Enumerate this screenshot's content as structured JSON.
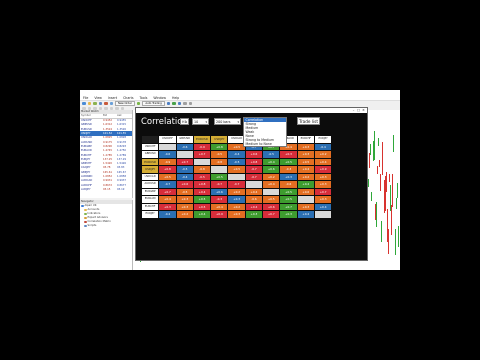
{
  "app": {
    "title": "",
    "menu": [
      "File",
      "View",
      "Insert",
      "Charts",
      "Tools",
      "Window",
      "Help"
    ],
    "toolbar_buttons": [
      "New Order",
      "Auto Trading"
    ]
  },
  "market_watch": {
    "title": "Market Watch",
    "columns": [
      "Symbol",
      "Bid",
      "Ask"
    ],
    "rows": [
      {
        "symbol": "USDCHF",
        "bid": "0.9452",
        "ask": "0.9455"
      },
      {
        "symbol": "GBPUSD",
        "bid": "1.6312",
        "ask": "1.6315"
      },
      {
        "symbol": "EURUSD",
        "bid": "1.3524",
        "ask": "1.3526"
      },
      {
        "symbol": "USDJPY",
        "bid": "101.52",
        "ask": "101.55",
        "selected": true
      },
      {
        "symbol": "USDCAD",
        "bid": "1.0825",
        "ask": "1.0828"
      },
      {
        "symbol": "AUDUSD",
        "bid": "0.9175",
        "ask": "0.9178"
      },
      {
        "symbol": "EURGBP",
        "bid": "0.8290",
        "ask": "0.8293"
      },
      {
        "symbol": "EURAUD",
        "bid": "1.4745",
        "ask": "1.4750"
      },
      {
        "symbol": "EURCHF",
        "bid": "1.2785",
        "ask": "1.2789"
      },
      {
        "symbol": "EURJPY",
        "bid": "137.25",
        "ask": "137.29"
      },
      {
        "symbol": "GBPCHF",
        "bid": "1.5420",
        "ask": "1.5426"
      },
      {
        "symbol": "CADJPY",
        "bid": "93.78",
        "ask": "93.83"
      },
      {
        "symbol": "GBPJPY",
        "bid": "165.61",
        "ask": "165.67"
      },
      {
        "symbol": "AUDNZD",
        "bid": "1.0852",
        "ask": "1.0858"
      },
      {
        "symbol": "AUDCAD",
        "bid": "0.9931",
        "ask": "0.9937"
      },
      {
        "symbol": "AUDCHF",
        "bid": "0.8672",
        "ask": "0.8677"
      },
      {
        "symbol": "AUDJPY",
        "bid": "93.15",
        "ask": "93.19"
      }
    ]
  },
  "navigator": {
    "title": "Navigator",
    "items": [
      "Alpari UK",
      "Accounts",
      "Indicators",
      "Expert Advisors",
      "Correlation Matrix",
      "Scripts"
    ]
  },
  "correlation": {
    "window_title": "",
    "title": "Correlation",
    "dropdown1": "H1",
    "dropdown2": "10",
    "dropdown3": "200 bars",
    "dropdown4": "Correlation",
    "trade_list": "Trade list",
    "menu_options": [
      "Correlation",
      "Strong",
      "Medium",
      "Weak",
      "None",
      "Strong to Medium",
      "Medium to None"
    ],
    "columns": [
      "USDCHF",
      "GBPUSD",
      "EURUSD",
      "USDJPY",
      "USDCAD",
      "AUDUSD",
      "EURGBP",
      "EURAUD",
      "EURCHF",
      "EURJPY"
    ],
    "rows": [
      {
        "label": "USDCHF",
        "cells": [
          [
            "diag",
            ""
          ],
          [
            "c-blue",
            "-0.6"
          ],
          [
            "c-red",
            "-0.9"
          ],
          [
            "c-green",
            "+0.8"
          ],
          [
            "c-orange",
            "+0.5"
          ],
          [
            "c-blue",
            "-0.7"
          ],
          [
            "c-green",
            "+0.7"
          ],
          [
            "c-orange",
            "+0.4"
          ],
          [
            "c-orange",
            "+0.3"
          ],
          [
            "c-blue",
            "-0.4"
          ]
        ]
      },
      {
        "label": "GBPUSD",
        "cells": [
          [
            "c-blue",
            "-0.6"
          ],
          [
            "diag",
            ""
          ],
          [
            "c-red",
            "+0.7"
          ],
          [
            "c-orange",
            "-0.5"
          ],
          [
            "c-blue",
            "-0.4"
          ],
          [
            "c-red",
            "+0.6"
          ],
          [
            "c-blue",
            "-0.5"
          ],
          [
            "c-red",
            "+0.3"
          ],
          [
            "c-orange",
            "+0.3"
          ],
          [
            "c-orange",
            "+0.2"
          ]
        ]
      },
      {
        "label": "EURUSD",
        "cells": [
          [
            "c-orange",
            "-0.9"
          ],
          [
            "c-red",
            "+0.7"
          ],
          [
            "diag",
            ""
          ],
          [
            "c-orange",
            "-0.8"
          ],
          [
            "c-blue",
            "-0.5"
          ],
          [
            "c-red",
            "+0.8"
          ],
          [
            "c-green",
            "+0.4"
          ],
          [
            "c-green",
            "+0.5"
          ],
          [
            "c-orange",
            "+0.5"
          ],
          [
            "c-orange",
            "+0.4"
          ]
        ]
      },
      {
        "label": "USDJPY",
        "cells": [
          [
            "c-red",
            "+0.8"
          ],
          [
            "c-blue",
            "-0.5"
          ],
          [
            "c-orange",
            "-0.8"
          ],
          [
            "diag",
            ""
          ],
          [
            "c-orange",
            "+0.5"
          ],
          [
            "c-red",
            "-0.7"
          ],
          [
            "c-green",
            "+0.6"
          ],
          [
            "c-orange",
            "-0.3"
          ],
          [
            "c-orange",
            "+0.4"
          ],
          [
            "c-red",
            "+0.9"
          ]
        ]
      },
      {
        "label": "USDCAD",
        "cells": [
          [
            "c-orange",
            "+0.5"
          ],
          [
            "c-blue",
            "-0.4"
          ],
          [
            "c-red",
            "-0.5"
          ],
          [
            "c-green",
            "+0.5"
          ],
          [
            "diag",
            ""
          ],
          [
            "c-red",
            "-0.7"
          ],
          [
            "c-orange",
            "+0.2"
          ],
          [
            "c-blue",
            "+0.3"
          ],
          [
            "c-orange",
            "+0.2"
          ],
          [
            "c-orange",
            "+0.3"
          ]
        ]
      },
      {
        "label": "AUDUSD",
        "cells": [
          [
            "c-blue",
            "-0.7"
          ],
          [
            "c-red",
            "+0.6"
          ],
          [
            "c-red",
            "+0.8"
          ],
          [
            "c-red",
            "-0.7"
          ],
          [
            "c-red",
            "-0.7"
          ],
          [
            "diag",
            ""
          ],
          [
            "c-orange",
            "+0.4"
          ],
          [
            "c-orange",
            "-0.6"
          ],
          [
            "c-green",
            "+0.4"
          ],
          [
            "c-orange",
            "+0.3"
          ]
        ]
      },
      {
        "label": "EURGBP",
        "cells": [
          [
            "c-red",
            "+0.7"
          ],
          [
            "c-orange",
            "-0.5"
          ],
          [
            "c-red",
            "+0.4"
          ],
          [
            "c-blue",
            "+0.6"
          ],
          [
            "c-orange",
            "+0.2"
          ],
          [
            "c-orange",
            "+0.4"
          ],
          [
            "diag",
            ""
          ],
          [
            "c-green",
            "+0.5"
          ],
          [
            "c-orange",
            "+0.6"
          ],
          [
            "c-red",
            "+0.7"
          ]
        ]
      },
      {
        "label": "EURAUD",
        "cells": [
          [
            "c-orange",
            "+0.4"
          ],
          [
            "c-orange",
            "+0.3"
          ],
          [
            "c-green",
            "+0.5"
          ],
          [
            "c-red",
            "-0.3"
          ],
          [
            "c-blue",
            "+0.3"
          ],
          [
            "c-orange",
            "-0.6"
          ],
          [
            "c-orange",
            "+0.5"
          ],
          [
            "c-green",
            "+0.5"
          ],
          [
            "diag",
            ""
          ],
          [
            "c-orange",
            "+0.3"
          ]
        ]
      },
      {
        "label": "EURCHF",
        "cells": [
          [
            "c-red",
            "+0.3"
          ],
          [
            "c-orange",
            "+0.3"
          ],
          [
            "c-red",
            "+0.5"
          ],
          [
            "c-orange",
            "+0.4"
          ],
          [
            "c-orange",
            "+0.2"
          ],
          [
            "c-red",
            "+0.4"
          ],
          [
            "c-red",
            "+0.6"
          ],
          [
            "c-green",
            "+0.7"
          ],
          [
            "c-orange",
            "+0.3"
          ],
          [
            "c-blue",
            "+0.4"
          ]
        ]
      },
      {
        "label": "EURJPY",
        "cells": [
          [
            "c-blue",
            "-0.4"
          ],
          [
            "c-orange",
            "+0.2"
          ],
          [
            "c-green",
            "+0.4"
          ],
          [
            "c-red",
            "+0.9"
          ],
          [
            "c-orange",
            "+0.3"
          ],
          [
            "c-green",
            "+0.3"
          ],
          [
            "c-red",
            "+0.7"
          ],
          [
            "c-green",
            "+0.3"
          ],
          [
            "c-blue",
            "+0.4"
          ],
          [
            "diag",
            ""
          ]
        ]
      }
    ]
  },
  "colors": {
    "c-blue": "#2b6fb3",
    "c-red": "#d72d3a",
    "c-orange": "#e36e22",
    "c-green": "#3e9c2f",
    "gold": "#d5ad34"
  }
}
